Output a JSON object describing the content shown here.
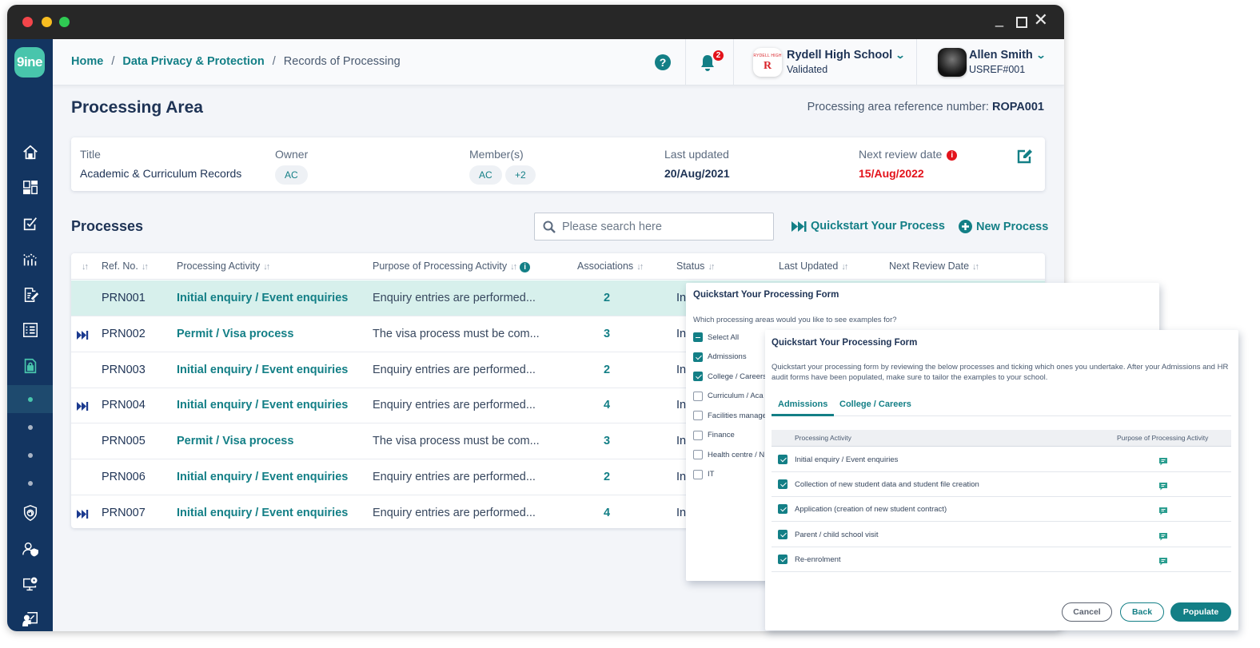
{
  "window": {
    "controls": {
      "minimize": "_",
      "close": "✕"
    }
  },
  "sidebar": {
    "logo": "9ine",
    "items": [
      {
        "icon": "home-icon"
      },
      {
        "icon": "dashboard-icon"
      },
      {
        "icon": "tasks-checkbox-icon"
      },
      {
        "icon": "analytics-icon"
      },
      {
        "icon": "document-edit-icon"
      },
      {
        "icon": "checklist-icon"
      },
      {
        "icon": "data-privacy-lock-icon",
        "active": true
      },
      {
        "icon": "cyber-shield-icon"
      },
      {
        "icon": "user-shield-icon"
      },
      {
        "icon": "monitor-settings-icon"
      },
      {
        "icon": "training-icon"
      }
    ],
    "subitems": 4
  },
  "topbar": {
    "breadcrumb": {
      "home": "Home",
      "section": "Data Privacy & Protection",
      "current": "Records of Processing",
      "separator": "/"
    },
    "help": "?",
    "notifications_count": "2",
    "school": {
      "name": "Rydell High School",
      "status": "Validated",
      "logo_text": "RYDELL HIGH",
      "logo_letter": "R"
    },
    "user": {
      "name": "Allen Smith",
      "ref": "USREF#001"
    }
  },
  "page": {
    "title": "Processing Area",
    "ref_label": "Processing area reference number:",
    "ref_value": "ROPA001"
  },
  "info_card": {
    "title_label": "Title",
    "title_value": "Academic & Curriculum Records",
    "owner_label": "Owner",
    "owner_chip": "AC",
    "members_label": "Member(s)",
    "members_chips": [
      "AC",
      "+2"
    ],
    "last_updated_label": "Last updated",
    "last_updated_value": "20/Aug/2021",
    "next_review_label": "Next review date",
    "next_review_value": "15/Aug/2022",
    "colors": {
      "overdue": "#e3131b"
    }
  },
  "processes": {
    "title": "Processes",
    "search_placeholder": "Please search here",
    "quickstart_label": "Quickstart Your Process",
    "new_process_label": "New Process",
    "columns": [
      "Ref. No.",
      "Processing Activity",
      "Purpose of Processing Activity",
      "Associations",
      "Status",
      "Last Updated",
      "Next Review Date"
    ],
    "rows": [
      {
        "ref": "PRN001",
        "activity": "Initial enquiry / Event enquiries",
        "purpose": "Enquiry entries are performed...",
        "associations": "2",
        "status": "In",
        "quickstart": false,
        "highlighted": true
      },
      {
        "ref": "PRN002",
        "activity": "Permit / Visa process",
        "purpose": "The visa process must be com...",
        "associations": "3",
        "status": "In",
        "quickstart": true
      },
      {
        "ref": "PRN003",
        "activity": "Initial enquiry / Event enquiries",
        "purpose": "Enquiry entries are performed...",
        "associations": "2",
        "status": "In",
        "quickstart": false
      },
      {
        "ref": "PRN004",
        "activity": "Initial enquiry / Event enquiries",
        "purpose": "Enquiry entries are performed...",
        "associations": "4",
        "status": "In",
        "quickstart": true
      },
      {
        "ref": "PRN005",
        "activity": "Permit / Visa process",
        "purpose": "The visa process must be com...",
        "associations": "3",
        "status": "In",
        "quickstart": false
      },
      {
        "ref": "PRN006",
        "activity": "Initial enquiry / Event enquiries",
        "purpose": "Enquiry entries are performed...",
        "associations": "2",
        "status": "In",
        "quickstart": false
      },
      {
        "ref": "PRN007",
        "activity": "Initial enquiry / Event enquiries",
        "purpose": "Enquiry entries are performed...",
        "associations": "4",
        "status": "In",
        "quickstart": true
      }
    ]
  },
  "quickstart_modal_1": {
    "title": "Quickstart Your Processing Form",
    "question": "Which processing areas would you like to see examples for?",
    "options": [
      {
        "label": "Select All",
        "state": "indeterminate"
      },
      {
        "label": "Admissions",
        "state": "checked"
      },
      {
        "label": "College / Careers",
        "state": "checked"
      },
      {
        "label": "Curriculum / Aca",
        "state": "unchecked"
      },
      {
        "label": "Facilities manage",
        "state": "unchecked"
      },
      {
        "label": "Finance",
        "state": "unchecked"
      },
      {
        "label": "Health centre / N",
        "state": "unchecked"
      },
      {
        "label": "IT",
        "state": "unchecked"
      }
    ]
  },
  "quickstart_modal_2": {
    "title": "Quickstart Your Processing Form",
    "description": "Quickstart your processing  form by reviewing the below processes and ticking which ones you undertake. After your Admissions and HR audit forms have been populated, make sure to tailor the examples to your school.",
    "tabs": [
      {
        "label": "Admissions",
        "active": true
      },
      {
        "label": "College / Careers",
        "active": false
      }
    ],
    "columns": [
      "Processing Activity",
      "Purpose of Processing Activity"
    ],
    "rows": [
      {
        "label": "Initial enquiry / Event enquiries",
        "checked": true
      },
      {
        "label": "Collection of new student data and student file creation",
        "checked": true
      },
      {
        "label": "Application (creation of new student contract)",
        "checked": true
      },
      {
        "label": "Parent / child school visit",
        "checked": true
      },
      {
        "label": "Re-enrolment",
        "checked": true
      }
    ],
    "buttons": {
      "cancel": "Cancel",
      "back": "Back",
      "populate": "Populate"
    }
  },
  "colors": {
    "brand_teal": "#137f86",
    "sidebar_navy": "#133561",
    "logo_green": "#48c5ac",
    "row_highlight": "#d7f0ec",
    "alert_red": "#e3131b"
  }
}
